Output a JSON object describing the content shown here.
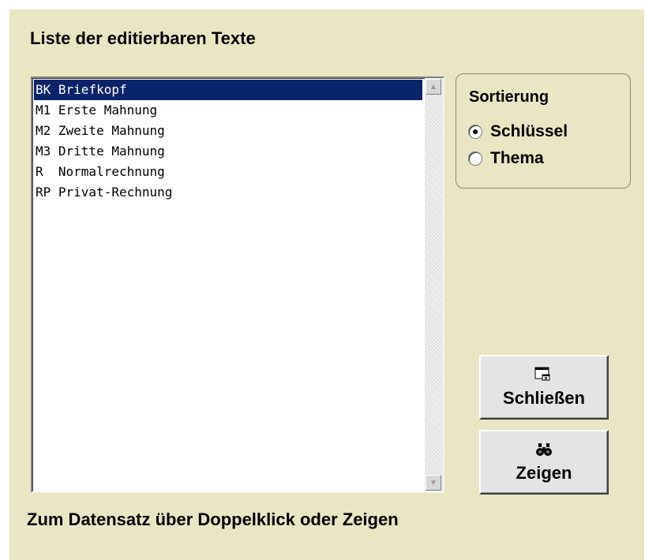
{
  "title": "Liste der editierbaren Texte",
  "list": {
    "items": [
      {
        "text": "BK Briefkopf",
        "selected": true
      },
      {
        "text": "M1 Erste Mahnung",
        "selected": false
      },
      {
        "text": "M2 Zweite Mahnung",
        "selected": false
      },
      {
        "text": "M3 Dritte Mahnung",
        "selected": false
      },
      {
        "text": "R  Normalrechnung",
        "selected": false
      },
      {
        "text": "RP Privat-Rechnung",
        "selected": false
      }
    ]
  },
  "sort": {
    "title": "Sortierung",
    "options": [
      {
        "label": "Schlüssel",
        "checked": true
      },
      {
        "label": "Thema",
        "checked": false
      }
    ]
  },
  "buttons": {
    "close": {
      "label": "Schließen",
      "icon": "window-close-icon"
    },
    "show": {
      "label": "Zeigen",
      "icon": "binoculars-icon"
    }
  },
  "footer": "Zum Datensatz über Doppelklick oder Zeigen",
  "colors": {
    "form_bg": "#e9e6c4",
    "selection": "#0a246a"
  }
}
